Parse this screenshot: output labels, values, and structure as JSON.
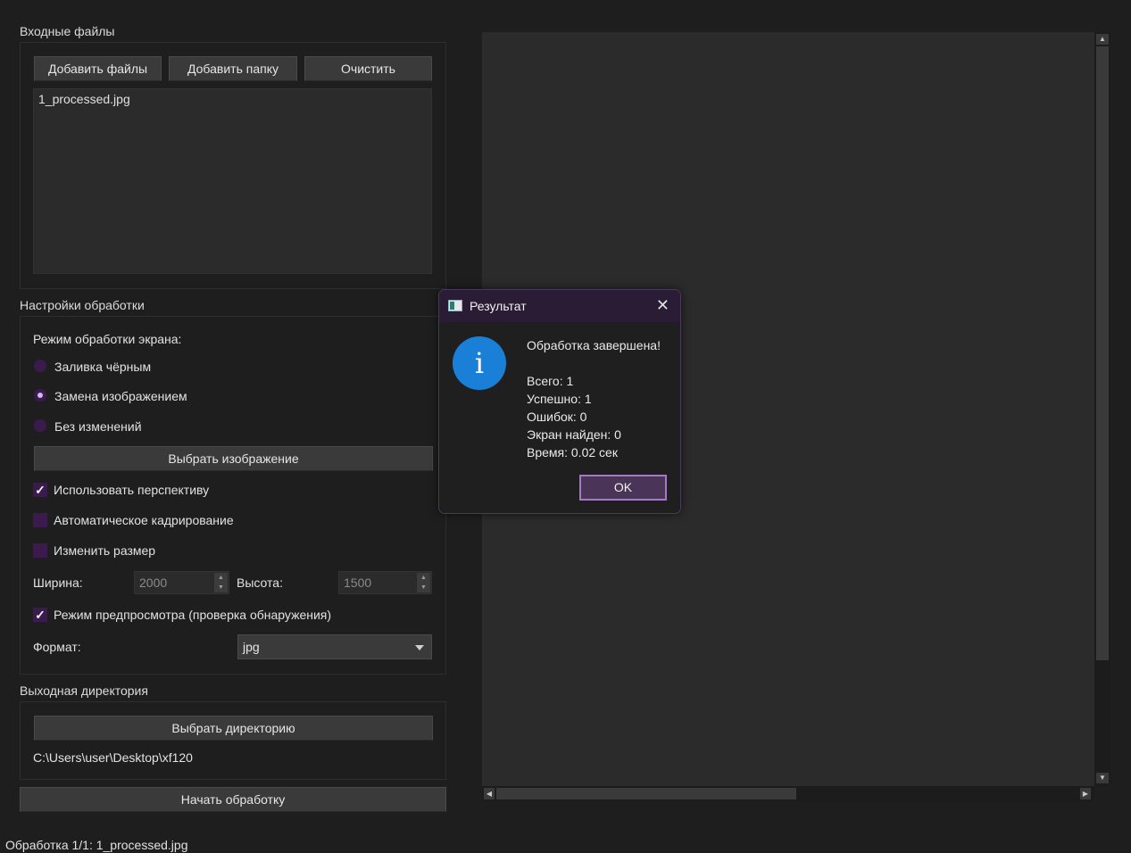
{
  "input": {
    "title": "Входные файлы",
    "add_files": "Добавить файлы",
    "add_folder": "Добавить папку",
    "clear": "Очистить",
    "files": [
      "1_processed.jpg"
    ]
  },
  "settings": {
    "title": "Настройки обработки",
    "mode_label": "Режим обработки экрана:",
    "modes": [
      {
        "label": "Заливка чёрным",
        "selected": false
      },
      {
        "label": "Замена изображением",
        "selected": true
      },
      {
        "label": "Без изменений",
        "selected": false
      }
    ],
    "choose_image": "Выбрать изображение",
    "use_perspective": {
      "label": "Использовать перспективу",
      "checked": true
    },
    "auto_crop": {
      "label": "Автоматическое кадрирование",
      "checked": false
    },
    "resize": {
      "label": "Изменить размер",
      "checked": false
    },
    "width_label": "Ширина:",
    "width_value": "2000",
    "height_label": "Высота:",
    "height_value": "1500",
    "preview_mode": {
      "label": "Режим предпросмотра (проверка обнаружения)",
      "checked": true
    },
    "format_label": "Формат:",
    "format_value": "jpg"
  },
  "output": {
    "title": "Выходная директория",
    "choose_dir": "Выбрать директорию",
    "path": "C:\\Users\\user\\Desktop\\xf120"
  },
  "start_button": "Начать обработку",
  "status_bar": "Обработка 1/1: 1_processed.jpg",
  "dialog": {
    "title": "Результат",
    "close": "✕",
    "icon": "info-icon",
    "heading": "Обработка завершена!",
    "lines": [
      "Всего: 1",
      "Успешно: 1",
      "Ошибок: 0",
      "Экран найден: 0",
      "Время: 0.02 сек"
    ],
    "ok": "OK"
  },
  "colors": {
    "background": "#1e1e1e",
    "accent": "#3b1b4e",
    "info": "#1a7fd6"
  }
}
